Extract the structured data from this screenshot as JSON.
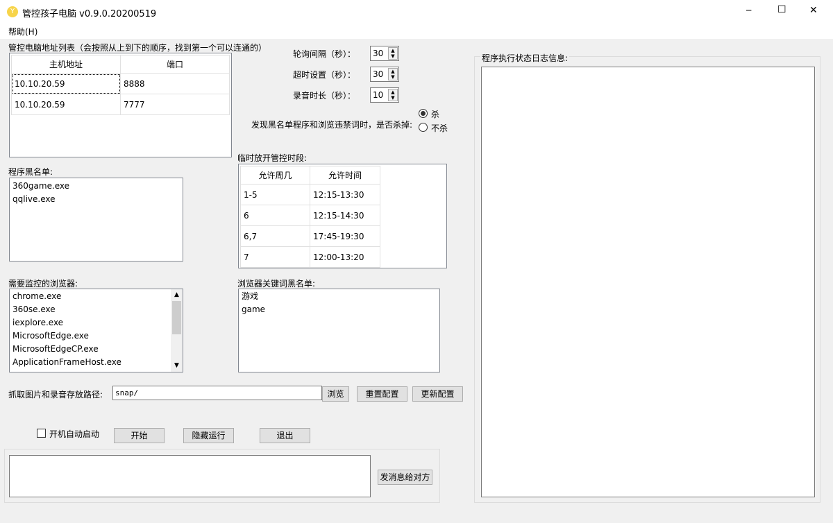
{
  "window": {
    "title": "管控孩子电脑 v0.9.0.20200519",
    "minimize": "─",
    "maximize": "☐",
    "close": "✕"
  },
  "menu": {
    "help": "帮助(H)"
  },
  "servers": {
    "label": "管控电脑地址列表（会按照从上到下的顺序，找到第一个可以连通的）",
    "headers": [
      "主机地址",
      "端口"
    ],
    "rows": [
      [
        "10.10.20.59",
        "8888"
      ],
      [
        "10.10.20.59",
        "7777"
      ]
    ]
  },
  "settings": {
    "poll_label": "轮询间隔（秒）：",
    "poll": "30",
    "timeout_label": "超时设置（秒）：",
    "timeout": "30",
    "record_label": "录音时长（秒）：",
    "record": "10",
    "kill_label": "发现黑名单程序和浏览违禁词时，是否杀掉:",
    "kill_yes": "杀",
    "kill_no": "不杀",
    "kill_selected": "杀"
  },
  "blacklist": {
    "label": "程序黑名单:",
    "items": [
      "360game.exe",
      "qqlive.exe"
    ]
  },
  "schedule": {
    "label": "临时放开管控时段:",
    "headers": [
      "允许周几",
      "允许时间"
    ],
    "rows": [
      [
        "1-5",
        "12:15-13:30"
      ],
      [
        "6",
        "12:15-14:30"
      ],
      [
        "6,7",
        "17:45-19:30"
      ],
      [
        "7",
        "12:00-13:20"
      ]
    ]
  },
  "browsers": {
    "label": "需要监控的浏览器:",
    "items": [
      "chrome.exe",
      "360se.exe",
      "iexplore.exe",
      "MicrosoftEdge.exe",
      "MicrosoftEdgeCP.exe",
      "ApplicationFrameHost.exe"
    ]
  },
  "keywords": {
    "label": "浏览器关键词黑名单:",
    "items": [
      "游戏",
      "game"
    ]
  },
  "path": {
    "label": "抓取图片和录音存放路径:",
    "value": "snap/",
    "browse": "浏览",
    "reset": "重置配置",
    "update": "更新配置"
  },
  "controls": {
    "autostart": "开机自动启动",
    "start": "开始",
    "hide": "隐藏运行",
    "exit": "退出"
  },
  "message": {
    "send": "发消息给对方"
  },
  "log": {
    "label": "程序执行状态日志信息:"
  }
}
